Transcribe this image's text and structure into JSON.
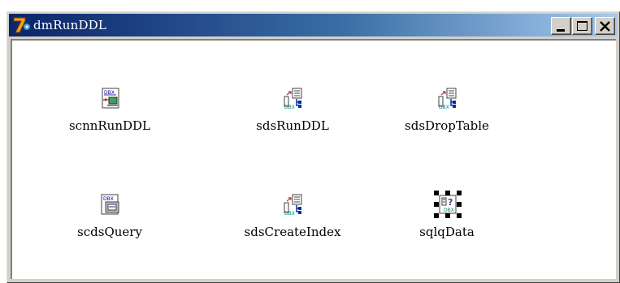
{
  "window": {
    "title": "dmRunDDL",
    "controls": {
      "minimize": "_",
      "maximize": "□",
      "close": "×"
    }
  },
  "components": [
    {
      "label": "scnnRunDDL",
      "icon": "dbx-connection-icon"
    },
    {
      "label": "sdsRunDDL",
      "icon": "dbx-dataset-icon"
    },
    {
      "label": "sdsDropTable",
      "icon": "dbx-dataset-icon"
    },
    {
      "label": "scdsQuery",
      "icon": "dbx-clientdataset-icon"
    },
    {
      "label": "sdsCreateIndex",
      "icon": "dbx-dataset-icon"
    },
    {
      "label": "sqlqData",
      "icon": "dbx-query-icon",
      "selected": true
    }
  ],
  "colors": {
    "titlebar_start": "#0a246a",
    "titlebar_end": "#a6caf0",
    "window_face": "#d4d0c8",
    "client_bg": "#ffffff"
  }
}
